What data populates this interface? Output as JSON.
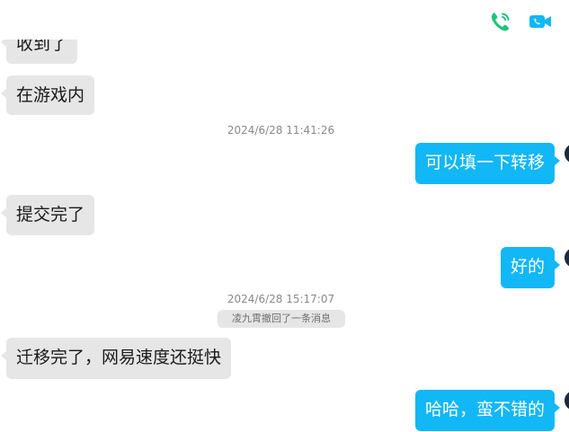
{
  "header": {
    "icons": [
      "voice-call-icon",
      "video-call-icon"
    ],
    "accent_green": "#1ec47a",
    "accent_blue": "#12b7f5"
  },
  "messages": [
    {
      "side": "in",
      "text": "收到了"
    },
    {
      "side": "in",
      "text": "在游戏内"
    },
    {
      "type": "timestamp",
      "text": "2024/6/28 11:41:26"
    },
    {
      "side": "out",
      "text": "可以填一下转移"
    },
    {
      "side": "in",
      "text": "提交完了"
    },
    {
      "side": "out",
      "text": "好的"
    },
    {
      "type": "timestamp",
      "text": "2024/6/28 15:17:07"
    },
    {
      "type": "system",
      "text": "凌九霄撤回了一条消息"
    },
    {
      "side": "in",
      "text": "迁移完了，网易速度还挺快"
    },
    {
      "side": "out",
      "text": "哈哈，蛮不错的"
    }
  ],
  "colors": {
    "incoming_bubble": "#e6e6e6",
    "outgoing_bubble": "#12b7f5",
    "timestamp_text": "#8a8a8a"
  }
}
